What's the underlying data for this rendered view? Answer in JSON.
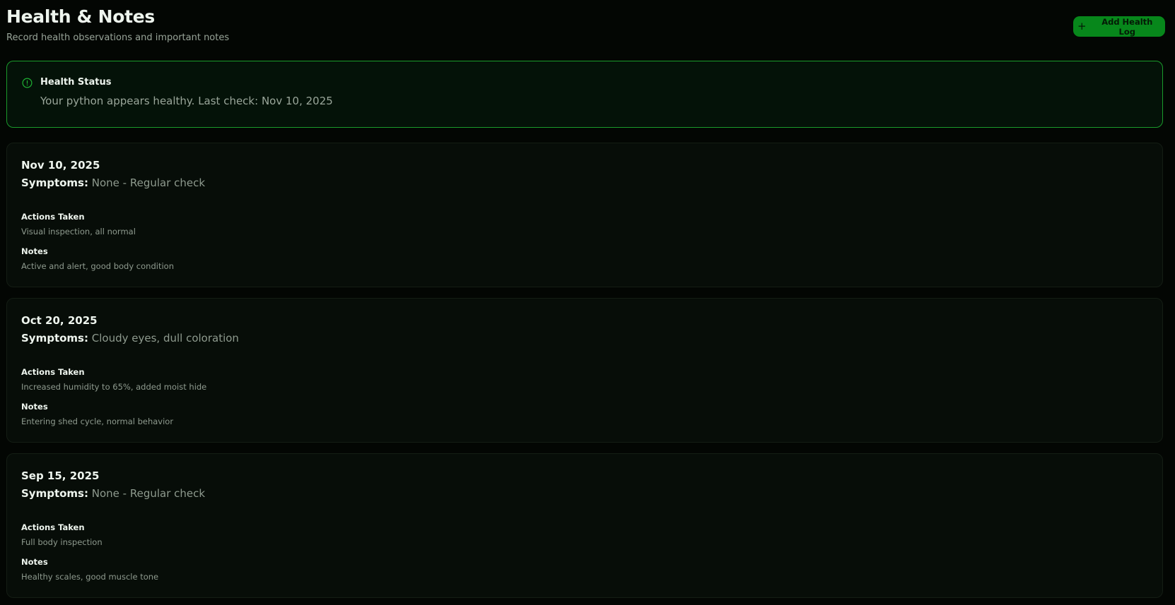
{
  "header": {
    "title": "Health & Notes",
    "subtitle": "Record health observations and important notes",
    "add_button_label": "Add Health Log",
    "add_button_icon": "plus-icon"
  },
  "status": {
    "icon": "alert-circle-icon",
    "title": "Health Status",
    "message": "Your python appears healthy. Last check: Nov 10, 2025"
  },
  "labels": {
    "symptoms": "Symptoms:",
    "actions_taken": "Actions Taken",
    "notes": "Notes"
  },
  "logs": [
    {
      "date": "Nov 10, 2025",
      "symptoms": "None - Regular check",
      "actions": "Visual inspection, all normal",
      "notes": "Active and alert, good body condition"
    },
    {
      "date": "Oct 20, 2025",
      "symptoms": "Cloudy eyes, dull coloration",
      "actions": "Increased humidity to 65%, added moist hide",
      "notes": "Entering shed cycle, normal behavior"
    },
    {
      "date": "Sep 15, 2025",
      "symptoms": "None - Regular check",
      "actions": "Full body inspection",
      "notes": "Healthy scales, good muscle tone"
    }
  ],
  "colors": {
    "accent": "#07871b",
    "status_border": "#1a9a2b",
    "background": "#030603"
  }
}
